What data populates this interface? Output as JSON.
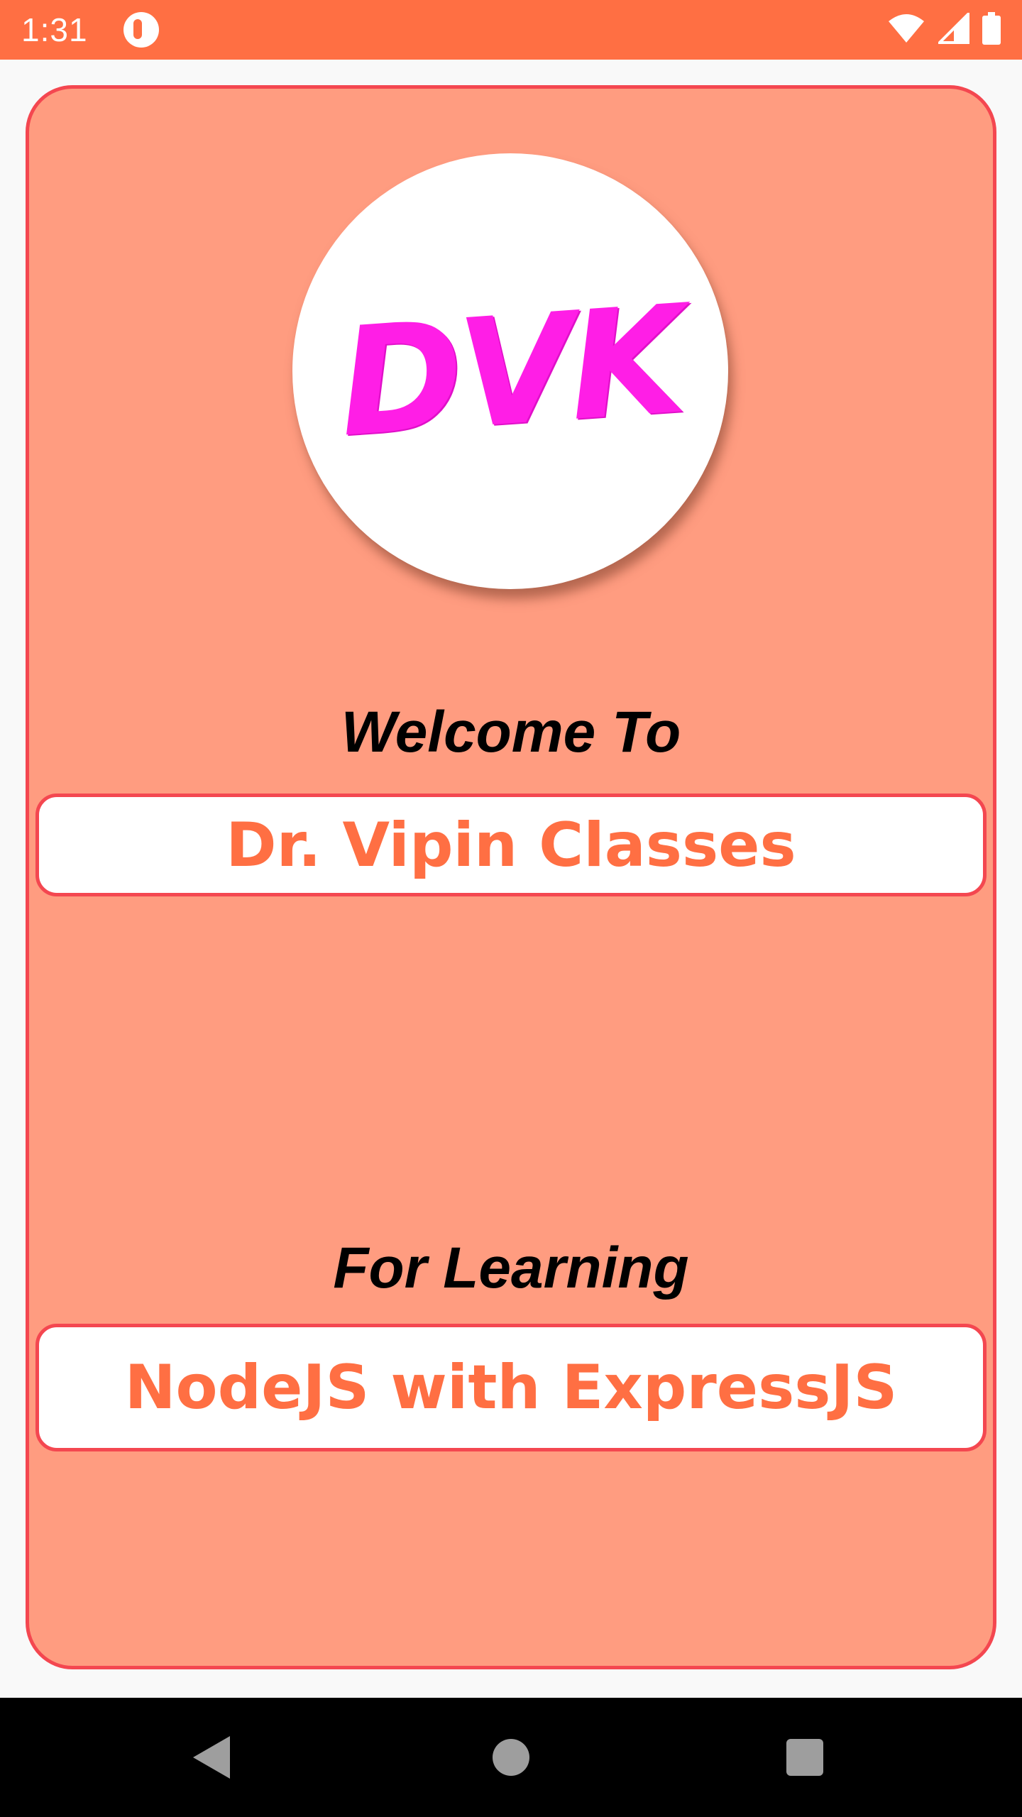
{
  "status_bar": {
    "time": "1:31",
    "app_icon": "notification-app-icon",
    "icons": [
      "wifi-icon",
      "cellular-signal-icon",
      "battery-icon"
    ],
    "background_color": "#ff6f43"
  },
  "card": {
    "background_color": "#ff9c80",
    "border_color": "#f44750",
    "logo_text": "DVK",
    "welcome_heading": "Welcome To",
    "institute_name": "Dr. Vipin Classes",
    "learning_heading": "For Learning",
    "course_name": "NodeJS with ExpressJS",
    "accent_text_color": "#ff6f43"
  },
  "nav_bar": {
    "buttons": [
      "back-icon",
      "home-icon",
      "recents-icon"
    ]
  }
}
